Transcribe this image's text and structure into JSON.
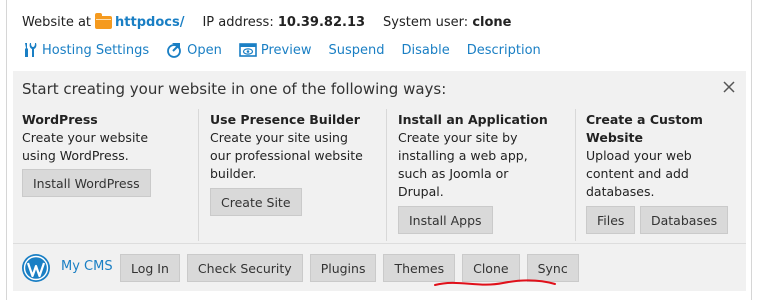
{
  "info": {
    "website_label": "Website at",
    "folder": "httpdocs/",
    "ip_label": "IP address:",
    "ip": "10.39.82.13",
    "user_label": "System user:",
    "user": "clone"
  },
  "actions": [
    {
      "label": "Hosting Settings",
      "icon": "tools-icon"
    },
    {
      "label": "Open",
      "icon": "open-icon"
    },
    {
      "label": "Preview",
      "icon": "preview-icon"
    },
    {
      "label": "Suspend"
    },
    {
      "label": "Disable"
    },
    {
      "label": "Description"
    }
  ],
  "start": {
    "title": "Start creating your website in one of the following ways:",
    "columns": [
      {
        "heading": "WordPress",
        "desc": [
          "Create your website",
          "using WordPress."
        ],
        "buttons": [
          "Install WordPress"
        ]
      },
      {
        "heading": "Use Presence Builder",
        "desc": [
          "Create your site using",
          "our professional website",
          "builder."
        ],
        "buttons": [
          "Create Site"
        ]
      },
      {
        "heading": "Install an Application",
        "desc": [
          "Create your site by",
          "installing a web app,",
          "such as Joomla or",
          "Drupal."
        ],
        "buttons": [
          "Install Apps"
        ]
      },
      {
        "heading": "Create a Custom",
        "heading2": "Website",
        "desc": [
          "Upload your web",
          "content and add",
          "databases."
        ],
        "buttons": [
          "Files",
          "Databases"
        ]
      }
    ]
  },
  "cms": {
    "label": "My CMS",
    "buttons": [
      "Log In",
      "Check Security",
      "Plugins",
      "Themes",
      "Clone",
      "Sync"
    ]
  },
  "colors": {
    "link": "#1a7fc4",
    "folder": "#f59a1e",
    "annotation": "#e0101a"
  }
}
